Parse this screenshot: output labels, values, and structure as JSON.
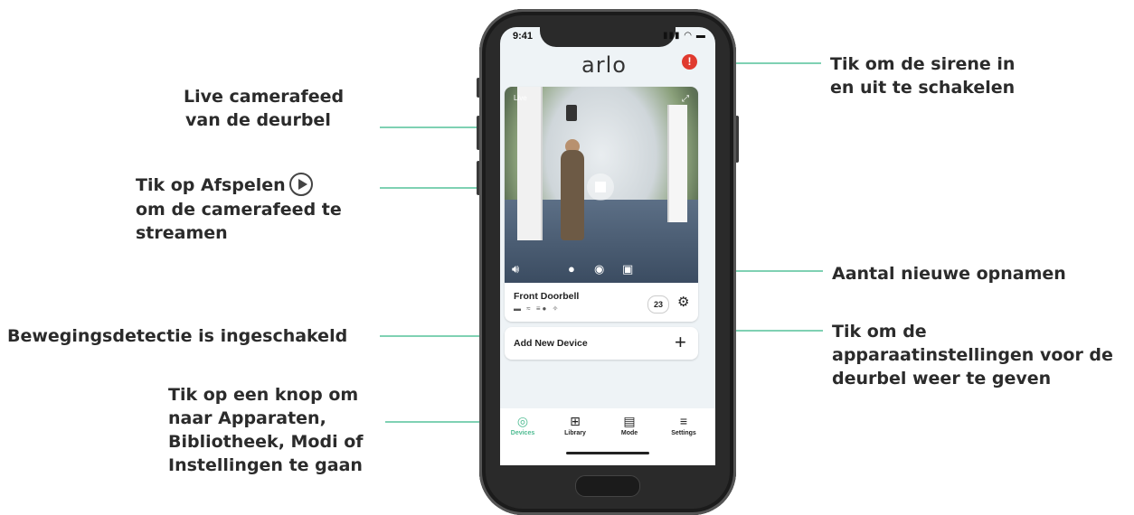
{
  "annotations": {
    "live_feed": [
      "Live camerafeed",
      "van de deurbel"
    ],
    "play": [
      "Tik op Afspelen",
      "om de camerafeed te",
      "streamen"
    ],
    "motion": [
      "Bewegingsdetectie is ingeschakeld"
    ],
    "nav": [
      "Tik op een knop om",
      "naar Apparaten,",
      "Bibliotheek, Modi of",
      "Instellingen te gaan"
    ],
    "siren": [
      "Tik om de sirene in",
      "en uit te schakelen"
    ],
    "new_recordings": [
      "Aantal nieuwe opnamen"
    ],
    "settings": [
      "Tik om de",
      "apparaatinstellingen voor de",
      "deurbel weer te geven"
    ]
  },
  "status_bar": {
    "time": "9:41",
    "icons": "signal-wifi-battery"
  },
  "app": {
    "logo": "arlo"
  },
  "device_card": {
    "live_label": "Live",
    "name": "Front Doorbell",
    "new_count": "23"
  },
  "add_device": {
    "label": "Add New Device"
  },
  "tabs": [
    {
      "label": "Devices",
      "icon": "devices-icon",
      "active": true
    },
    {
      "label": "Library",
      "icon": "library-icon"
    },
    {
      "label": "Mode",
      "icon": "mode-icon"
    },
    {
      "label": "Settings",
      "icon": "menu-icon"
    }
  ],
  "colors": {
    "accent": "#4dbb91",
    "leader": "#7fd1b3",
    "siren": "#e03a2f"
  }
}
